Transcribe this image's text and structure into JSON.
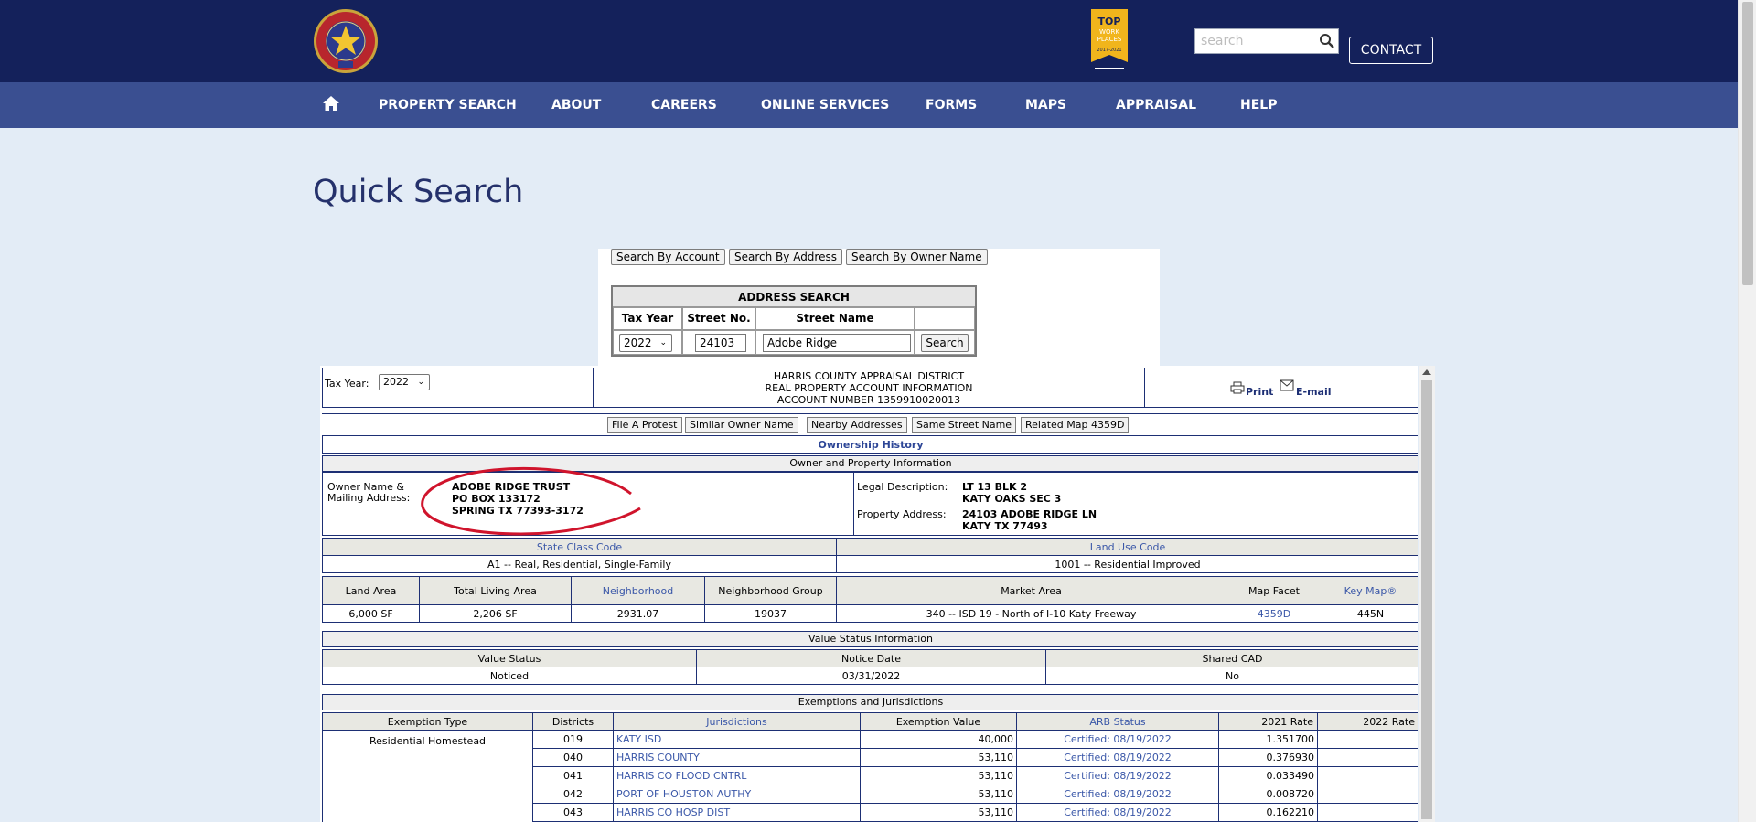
{
  "header": {
    "logo_alt": "Harris County Appraisal District Texas",
    "badge": {
      "line1": "TOP",
      "line2": "WORK",
      "line3": "PLACES",
      "years": "2017-2021"
    },
    "search_placeholder": "search",
    "contact_label": "CONTACT"
  },
  "nav": {
    "items": [
      "PROPERTY SEARCH",
      "ABOUT",
      "CAREERS",
      "ONLINE SERVICES",
      "FORMS",
      "MAPS",
      "APPRAISAL",
      "HELP"
    ]
  },
  "page_title": "Quick Search",
  "search_panel": {
    "buttons": [
      "Search By Account",
      "Search By Address",
      "Search By Owner Name"
    ],
    "table_title": "ADDRESS SEARCH",
    "col_tax_year": "Tax Year",
    "col_street_no": "Street No.",
    "col_street_name": "Street Name",
    "tax_year": "2022",
    "street_no": "24103",
    "street_name": "Adobe Ridge",
    "search_label": "Search"
  },
  "report": {
    "tax_year_label": "Tax Year:",
    "tax_year": "2022",
    "title1": "HARRIS COUNTY APPRAISAL DISTRICT",
    "title2": "REAL PROPERTY ACCOUNT INFORMATION",
    "title3": "ACCOUNT NUMBER 1359910020013",
    "print_label": "Print",
    "email_label": "E-mail",
    "actions": [
      "File A Protest",
      "Similar Owner Name",
      "Nearby Addresses",
      "Same Street Name",
      "Related Map 4359D"
    ],
    "ownership_history": "Ownership History",
    "owner_section": "Owner and Property Information",
    "owner_label1": "Owner Name &",
    "owner_label2": "Mailing Address:",
    "owner_line1": "ADOBE RIDGE TRUST",
    "owner_line2": "PO BOX 133172",
    "owner_line3": "SPRING TX 77393-3172",
    "legal_label": "Legal Description:",
    "legal_line1": "LT 13 BLK 2",
    "legal_line2": "KATY OAKS SEC 3",
    "address_label": "Property Address:",
    "address_line1": "24103 ADOBE RIDGE LN",
    "address_line2": "KATY TX 77493",
    "state_class_header": "State Class Code",
    "land_use_header": "Land Use Code",
    "state_class_value": "A1 -- Real, Residential, Single-Family",
    "land_use_value": "1001 -- Residential Improved",
    "detail_headers": [
      "Land Area",
      "Total Living Area",
      "Neighborhood",
      "Neighborhood Group",
      "Market Area",
      "Map Facet",
      "Key Map®"
    ],
    "detail_values": [
      "6,000 SF",
      "2,206 SF",
      "2931.07",
      "19037",
      "340 -- ISD 19 - North of I-10 Katy Freeway",
      "4359D",
      "445N"
    ],
    "value_status_section": "Value Status Information",
    "vs_headers": [
      "Value Status",
      "Notice Date",
      "Shared CAD"
    ],
    "vs_values": [
      "Noticed",
      "03/31/2022",
      "No"
    ],
    "exemptions_section": "Exemptions and Jurisdictions",
    "ex_headers": [
      "Exemption Type",
      "Districts",
      "Jurisdictions",
      "Exemption Value",
      "ARB Status",
      "2021 Rate",
      "2022 Rate"
    ],
    "exemption_type": "Residential Homestead",
    "ex_rows": [
      {
        "district": "019",
        "jurisdiction": "KATY ISD",
        "value": "40,000",
        "arb": "Certified: 08/19/2022",
        "rate2021": "1.351700",
        "rate2022": ""
      },
      {
        "district": "040",
        "jurisdiction": "HARRIS COUNTY",
        "value": "53,110",
        "arb": "Certified: 08/19/2022",
        "rate2021": "0.376930",
        "rate2022": ""
      },
      {
        "district": "041",
        "jurisdiction": "HARRIS CO FLOOD CNTRL",
        "value": "53,110",
        "arb": "Certified: 08/19/2022",
        "rate2021": "0.033490",
        "rate2022": ""
      },
      {
        "district": "042",
        "jurisdiction": "PORT OF HOUSTON AUTHY",
        "value": "53,110",
        "arb": "Certified: 08/19/2022",
        "rate2021": "0.008720",
        "rate2022": ""
      },
      {
        "district": "043",
        "jurisdiction": "HARRIS CO HOSP DIST",
        "value": "53,110",
        "arb": "Certified: 08/19/2022",
        "rate2021": "0.162210",
        "rate2022": ""
      }
    ]
  },
  "colors": {
    "header_bg": "#14215b",
    "nav_bg": "#3a4f91",
    "page_bg": "#e3ecf6",
    "link": "#3a57a8",
    "annotation": "#d0142c"
  },
  "icons": [
    "home-icon",
    "search-icon",
    "print-icon",
    "email-icon"
  ]
}
